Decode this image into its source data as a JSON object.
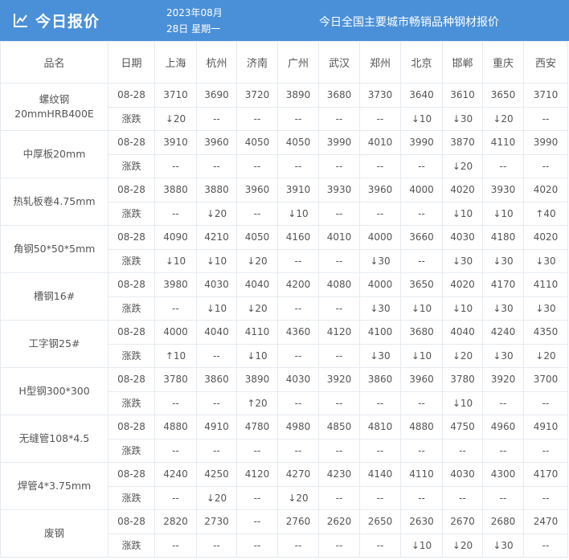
{
  "header": {
    "title": "今日报价",
    "date_line1": "2023年08月",
    "date_line2": "28日  星期一",
    "subtitle": "今日全国主要城市畅销品种钢材报价",
    "bg_color": "#4a90d9"
  },
  "columns": {
    "product": "品名",
    "date": "日期",
    "cities": [
      "上海",
      "杭州",
      "济南",
      "广州",
      "武汉",
      "郑州",
      "北京",
      "邯郸",
      "重庆",
      "西安"
    ]
  },
  "change_label": "涨跌",
  "products": [
    {
      "name_lines": [
        "螺纹钢",
        "20mmHRB400E"
      ],
      "date": "08-28",
      "prices": [
        "3710",
        "3690",
        "3720",
        "3890",
        "3680",
        "3730",
        "3640",
        "3610",
        "3650",
        "3710"
      ],
      "changes": [
        {
          "dir": "down",
          "text": "↓20"
        },
        {
          "dir": "flat",
          "text": "--"
        },
        {
          "dir": "flat",
          "text": "--"
        },
        {
          "dir": "flat",
          "text": "--"
        },
        {
          "dir": "flat",
          "text": "--"
        },
        {
          "dir": "flat",
          "text": "--"
        },
        {
          "dir": "down",
          "text": "↓10"
        },
        {
          "dir": "down",
          "text": "↓30"
        },
        {
          "dir": "down",
          "text": "↓20"
        },
        {
          "dir": "flat",
          "text": "--"
        }
      ]
    },
    {
      "name_lines": [
        "中厚板20mm"
      ],
      "date": "08-28",
      "prices": [
        "3910",
        "3960",
        "4050",
        "4050",
        "3990",
        "4010",
        "3990",
        "3870",
        "4110",
        "3990"
      ],
      "changes": [
        {
          "dir": "flat",
          "text": "--"
        },
        {
          "dir": "flat",
          "text": "--"
        },
        {
          "dir": "flat",
          "text": "--"
        },
        {
          "dir": "flat",
          "text": "--"
        },
        {
          "dir": "flat",
          "text": "--"
        },
        {
          "dir": "flat",
          "text": "--"
        },
        {
          "dir": "flat",
          "text": "--"
        },
        {
          "dir": "down",
          "text": "↓20"
        },
        {
          "dir": "flat",
          "text": "--"
        },
        {
          "dir": "flat",
          "text": "--"
        }
      ]
    },
    {
      "name_lines": [
        "热轧板卷4.75mm"
      ],
      "date": "08-28",
      "prices": [
        "3880",
        "3880",
        "3960",
        "3910",
        "3930",
        "3960",
        "4000",
        "4020",
        "3930",
        "4020"
      ],
      "changes": [
        {
          "dir": "flat",
          "text": "--"
        },
        {
          "dir": "down",
          "text": "↓20"
        },
        {
          "dir": "flat",
          "text": "--"
        },
        {
          "dir": "down",
          "text": "↓10"
        },
        {
          "dir": "flat",
          "text": "--"
        },
        {
          "dir": "flat",
          "text": "--"
        },
        {
          "dir": "flat",
          "text": "--"
        },
        {
          "dir": "down",
          "text": "↓10"
        },
        {
          "dir": "down",
          "text": "↓10"
        },
        {
          "dir": "up",
          "text": "↑40"
        }
      ]
    },
    {
      "name_lines": [
        "角钢50*50*5mm"
      ],
      "date": "08-28",
      "prices": [
        "4090",
        "4210",
        "4050",
        "4160",
        "4010",
        "4000",
        "3660",
        "4030",
        "4180",
        "4020"
      ],
      "changes": [
        {
          "dir": "down",
          "text": "↓10"
        },
        {
          "dir": "down",
          "text": "↓10"
        },
        {
          "dir": "down",
          "text": "↓20"
        },
        {
          "dir": "flat",
          "text": "--"
        },
        {
          "dir": "flat",
          "text": "--"
        },
        {
          "dir": "down",
          "text": "↓30"
        },
        {
          "dir": "flat",
          "text": "--"
        },
        {
          "dir": "down",
          "text": "↓30"
        },
        {
          "dir": "down",
          "text": "↓30"
        },
        {
          "dir": "down",
          "text": "↓30"
        }
      ]
    },
    {
      "name_lines": [
        "槽钢16#"
      ],
      "date": "08-28",
      "prices": [
        "3980",
        "4030",
        "4040",
        "4200",
        "4080",
        "4000",
        "3650",
        "4020",
        "4170",
        "4110"
      ],
      "changes": [
        {
          "dir": "flat",
          "text": "--"
        },
        {
          "dir": "down",
          "text": "↓10"
        },
        {
          "dir": "down",
          "text": "↓20"
        },
        {
          "dir": "flat",
          "text": "--"
        },
        {
          "dir": "flat",
          "text": "--"
        },
        {
          "dir": "down",
          "text": "↓30"
        },
        {
          "dir": "down",
          "text": "↓10"
        },
        {
          "dir": "down",
          "text": "↓10"
        },
        {
          "dir": "down",
          "text": "↓30"
        },
        {
          "dir": "down",
          "text": "↓30"
        }
      ]
    },
    {
      "name_lines": [
        "工字钢25#"
      ],
      "date": "08-28",
      "prices": [
        "4000",
        "4040",
        "4110",
        "4360",
        "4120",
        "4100",
        "3680",
        "4040",
        "4240",
        "4350"
      ],
      "changes": [
        {
          "dir": "up",
          "text": "↑10"
        },
        {
          "dir": "flat",
          "text": "--"
        },
        {
          "dir": "down",
          "text": "↓10"
        },
        {
          "dir": "flat",
          "text": "--"
        },
        {
          "dir": "flat",
          "text": "--"
        },
        {
          "dir": "down",
          "text": "↓30"
        },
        {
          "dir": "down",
          "text": "↓10"
        },
        {
          "dir": "down",
          "text": "↓20"
        },
        {
          "dir": "down",
          "text": "↓30"
        },
        {
          "dir": "down",
          "text": "↓20"
        }
      ]
    },
    {
      "name_lines": [
        "H型钢300*300"
      ],
      "date": "08-28",
      "prices": [
        "3780",
        "3860",
        "3890",
        "4030",
        "3920",
        "3860",
        "3960",
        "3780",
        "3920",
        "3700"
      ],
      "changes": [
        {
          "dir": "flat",
          "text": "--"
        },
        {
          "dir": "flat",
          "text": "--"
        },
        {
          "dir": "up",
          "text": "↑20"
        },
        {
          "dir": "flat",
          "text": "--"
        },
        {
          "dir": "flat",
          "text": "--"
        },
        {
          "dir": "flat",
          "text": "--"
        },
        {
          "dir": "flat",
          "text": "--"
        },
        {
          "dir": "down",
          "text": "↓10"
        },
        {
          "dir": "flat",
          "text": "--"
        },
        {
          "dir": "flat",
          "text": "--"
        }
      ]
    },
    {
      "name_lines": [
        "无缝管108*4.5"
      ],
      "date": "08-28",
      "prices": [
        "4880",
        "4910",
        "4780",
        "4980",
        "4850",
        "4810",
        "4880",
        "4750",
        "4960",
        "4910"
      ],
      "changes": [
        {
          "dir": "flat",
          "text": "--"
        },
        {
          "dir": "flat",
          "text": "--"
        },
        {
          "dir": "flat",
          "text": "--"
        },
        {
          "dir": "flat",
          "text": "--"
        },
        {
          "dir": "flat",
          "text": "--"
        },
        {
          "dir": "flat",
          "text": "--"
        },
        {
          "dir": "flat",
          "text": "--"
        },
        {
          "dir": "flat",
          "text": "--"
        },
        {
          "dir": "flat",
          "text": "--"
        },
        {
          "dir": "flat",
          "text": "--"
        }
      ]
    },
    {
      "name_lines": [
        "焊管4*3.75mm"
      ],
      "date": "08-28",
      "prices": [
        "4240",
        "4250",
        "4120",
        "4270",
        "4230",
        "4140",
        "4110",
        "4030",
        "4300",
        "4170"
      ],
      "changes": [
        {
          "dir": "flat",
          "text": "--"
        },
        {
          "dir": "down",
          "text": "↓20"
        },
        {
          "dir": "flat",
          "text": "--"
        },
        {
          "dir": "down",
          "text": "↓20"
        },
        {
          "dir": "flat",
          "text": "--"
        },
        {
          "dir": "flat",
          "text": "--"
        },
        {
          "dir": "flat",
          "text": "--"
        },
        {
          "dir": "flat",
          "text": "--"
        },
        {
          "dir": "flat",
          "text": "--"
        },
        {
          "dir": "flat",
          "text": "--"
        }
      ]
    },
    {
      "name_lines": [
        "废钢"
      ],
      "date": "08-28",
      "prices": [
        "2820",
        "2730",
        "--",
        "2760",
        "2620",
        "2650",
        "2630",
        "2670",
        "2680",
        "2470"
      ],
      "changes": [
        {
          "dir": "flat",
          "text": "--"
        },
        {
          "dir": "flat",
          "text": "--"
        },
        {
          "dir": "flat",
          "text": "--"
        },
        {
          "dir": "flat",
          "text": "--"
        },
        {
          "dir": "flat",
          "text": "--"
        },
        {
          "dir": "flat",
          "text": "--"
        },
        {
          "dir": "down",
          "text": "↓10"
        },
        {
          "dir": "down",
          "text": "↓20"
        },
        {
          "dir": "down",
          "text": "↓30"
        },
        {
          "dir": "flat",
          "text": "--"
        }
      ]
    }
  ]
}
